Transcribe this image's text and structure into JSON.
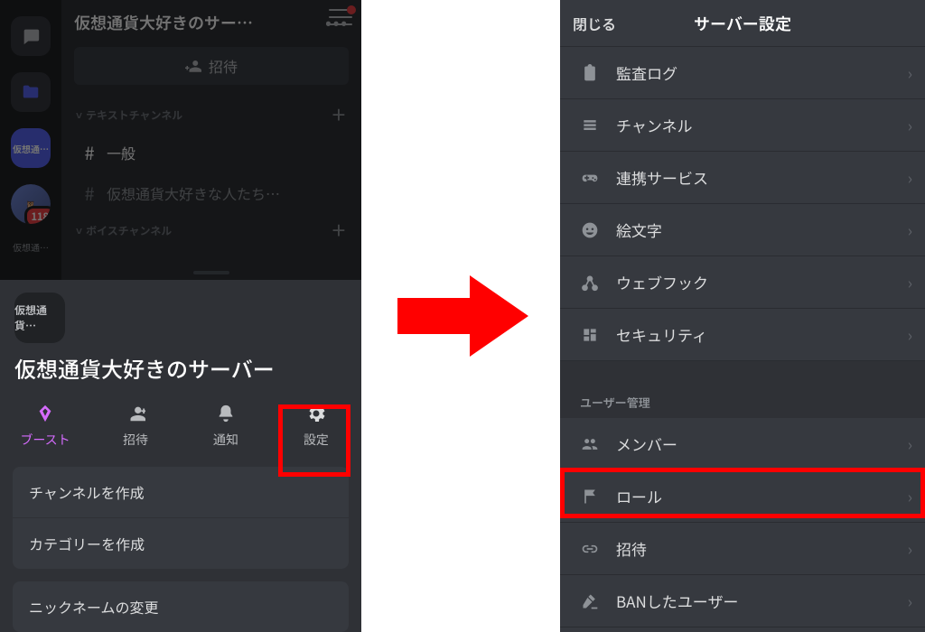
{
  "left": {
    "server_name_truncated": "仮想通貨大好きのサー…",
    "server_name_full_title": "仮想通貨大好きのサーバー",
    "rail": {
      "selected_label": "仮想通…",
      "badge_count": "118",
      "bottom_label": "仮想通…"
    },
    "invite_label": "招待",
    "cat_text": "テキストチャンネル",
    "cat_voice": "ボイスチャンネル",
    "ch_general": "一般",
    "ch_long": "仮想通貨大好きな人たち…",
    "sheet_tile_label": "仮想通貨…",
    "actions": {
      "boost": "ブースト",
      "invite": "招待",
      "notify": "通知",
      "settings": "設定"
    },
    "sheet_items": {
      "create_channel": "チャンネルを作成",
      "create_category": "カテゴリーを作成",
      "change_nickname": "ニックネームの変更"
    }
  },
  "right": {
    "close": "閉じる",
    "title": "サーバー設定",
    "items": {
      "audit": "監査ログ",
      "channels": "チャンネル",
      "integrations": "連携サービス",
      "emoji": "絵文字",
      "webhooks": "ウェブフック",
      "security": "セキュリティ"
    },
    "section_user_mgmt": "ユーザー管理",
    "items2": {
      "members": "メンバー",
      "roles": "ロール",
      "invites": "招待",
      "bans": "BANしたユーザー"
    }
  }
}
